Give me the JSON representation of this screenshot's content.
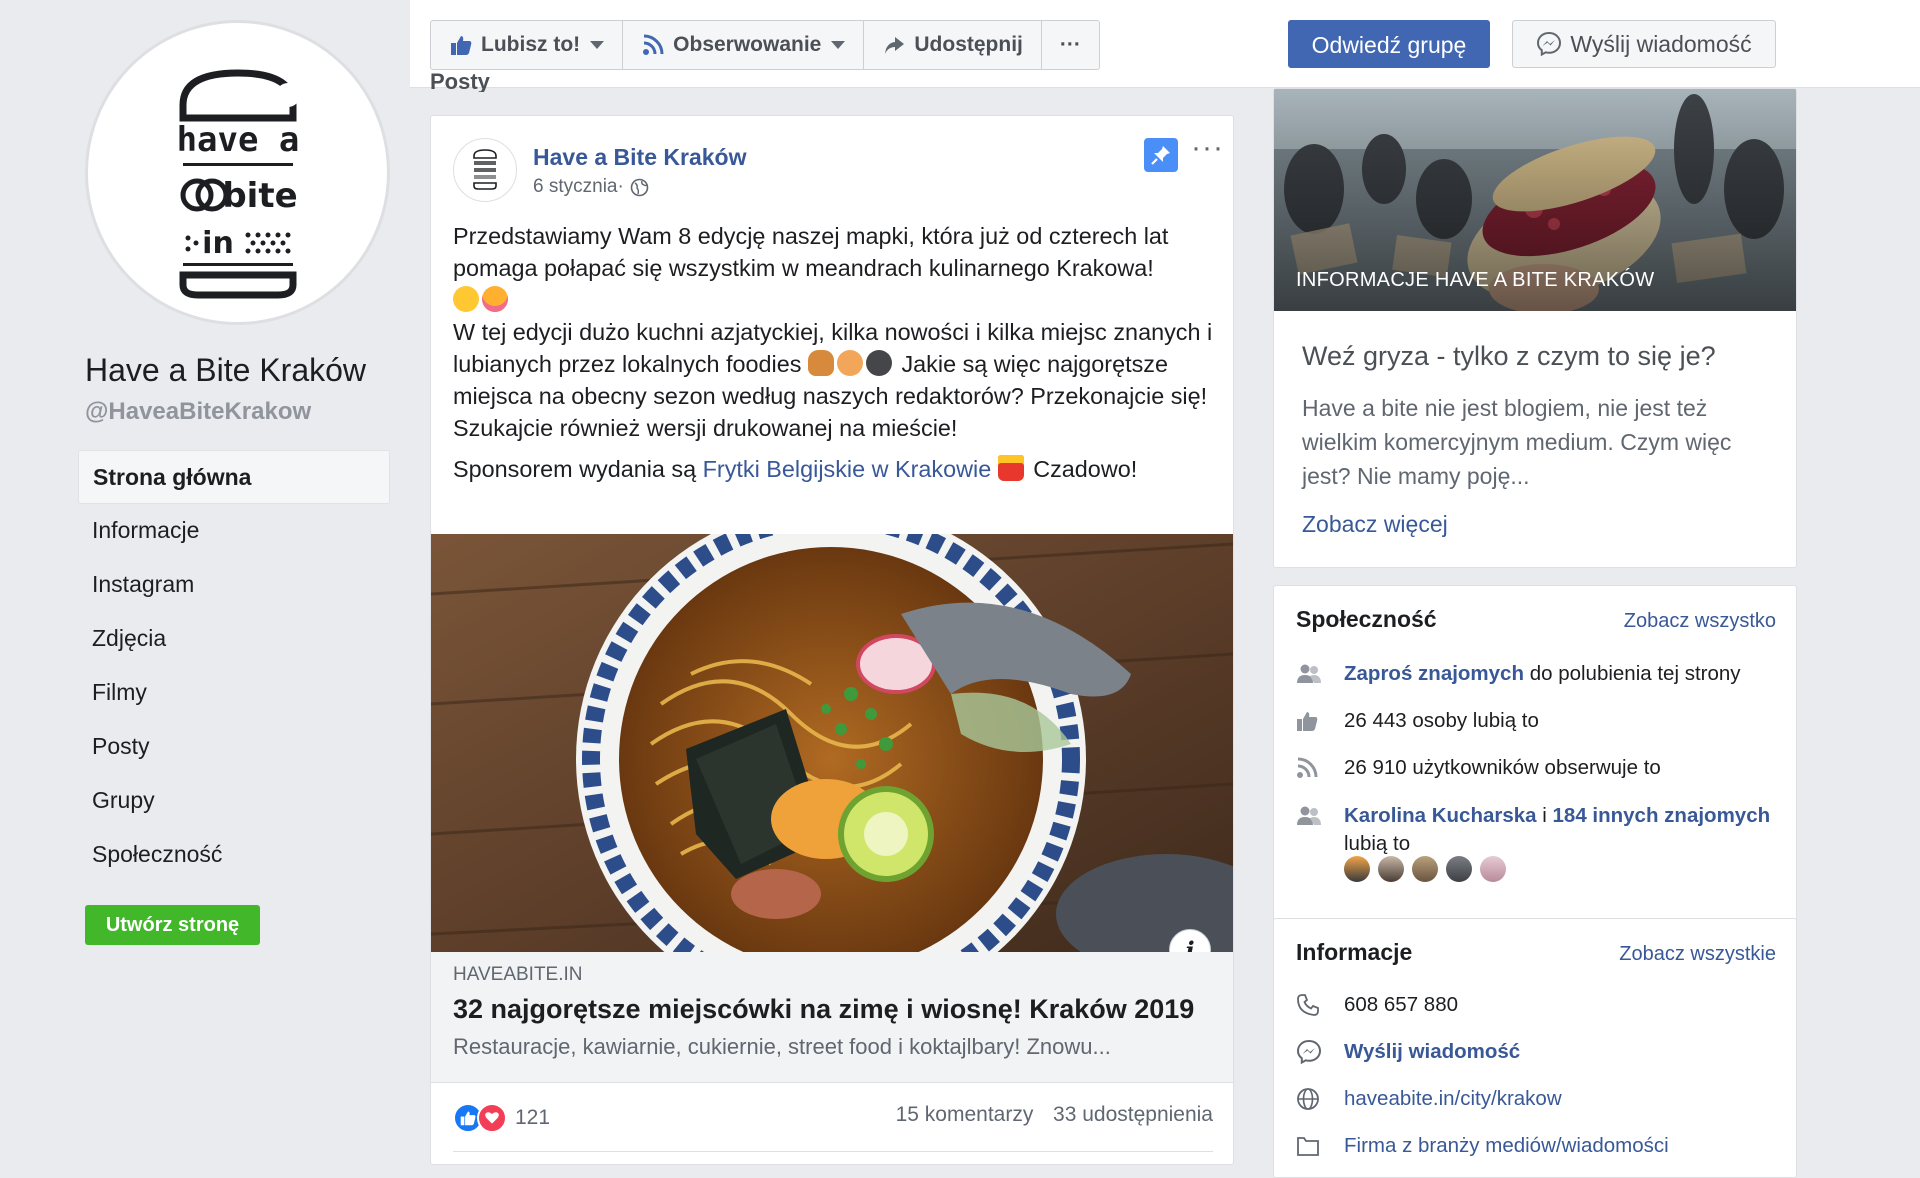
{
  "page": {
    "name": "Have a Bite Kraków",
    "handle": "@HaveaBiteKrakow"
  },
  "logo": {
    "line1": "have a",
    "line2": "bite",
    "line3": "in"
  },
  "nav": {
    "items": [
      {
        "label": "Strona główna",
        "active": true
      },
      {
        "label": "Informacje"
      },
      {
        "label": "Instagram"
      },
      {
        "label": "Zdjęcia"
      },
      {
        "label": "Filmy"
      },
      {
        "label": "Posty"
      },
      {
        "label": "Grupy"
      },
      {
        "label": "Społeczność"
      }
    ],
    "create_page": "Utwórz stronę"
  },
  "toolbar": {
    "like": "Lubisz to!",
    "follow": "Obserwowanie",
    "share": "Udostępnij",
    "more": "···",
    "visit_group": "Odwiedź grupę",
    "send_message": "Wyślij wiadomość"
  },
  "posts_heading": "Posty",
  "post": {
    "author": "Have a Bite Kraków",
    "date": "6 stycznia",
    "date_sep": " · ",
    "more": "···",
    "text_p1": "Przedstawiamy Wam 8 edycję naszej mapki, która już od czterech lat pomaga połapać się wszystkim w meandrach kulinarnego Krakowa!",
    "text_p2a": "W tej edycji dużo kuchni azjatyckiej, kilka nowości i kilka miejsc znanych i lubianych przez lokalnych foodies",
    "text_p2b": "Jakie są więc najgorętsze miejsca na obecny sezon według naszych redaktorów? Przekonajcie się!",
    "text_p3": "Szukajcie również wersji drukowanej na mieście!",
    "sponsor_prefix": "Sponsorem wydania są ",
    "sponsor_link": "Frytki Belgijskie w Krakowie",
    "sponsor_suffix": " Czadowo!",
    "link": {
      "domain": "HAVEABITE.IN",
      "title": "32 najgorętsze miejscówki na zimę i wiosnę! Kraków 2019",
      "description": "Restauracje, kawiarnie, cukiernie, street food i koktajlbary! Znowu..."
    },
    "info_badge": "i",
    "reactions_count": "121",
    "comments": "15 komentarzy",
    "shares": "33 udostępnienia"
  },
  "about": {
    "photo_label": "INFORMACJE HAVE A BITE KRAKÓW",
    "title": "Weź gryza - tylko z czym to się je?",
    "description": "Have a bite nie jest blogiem, nie jest też wielkim komercyjnym medium. Czym więc jest? Nie mamy poję...",
    "see_more": "Zobacz więcej"
  },
  "community": {
    "heading": "Społeczność",
    "see_all": "Zobacz wszystko",
    "invite_link": "Zaproś znajomych",
    "invite_rest": " do polubienia tej strony",
    "likes": "26 443 osoby lubią to",
    "followers": "26 910 użytkowników obserwuje to",
    "friend_name": "Karolina Kucharska",
    "friend_and": " i ",
    "friend_others": "184 innych znajomych",
    "friend_suffix": "lubią to"
  },
  "info": {
    "heading": "Informacje",
    "see_all": "Zobacz wszystkie",
    "phone": "608 657 880",
    "message": "Wyślij wiadomość",
    "website": "haveabite.in/city/krakow",
    "category": "Firma z branży mediów/wiadomości"
  },
  "colors": {
    "brand_blue": "#4267b2",
    "link_blue": "#385898",
    "green": "#42b72a",
    "background": "#e9ebee"
  }
}
